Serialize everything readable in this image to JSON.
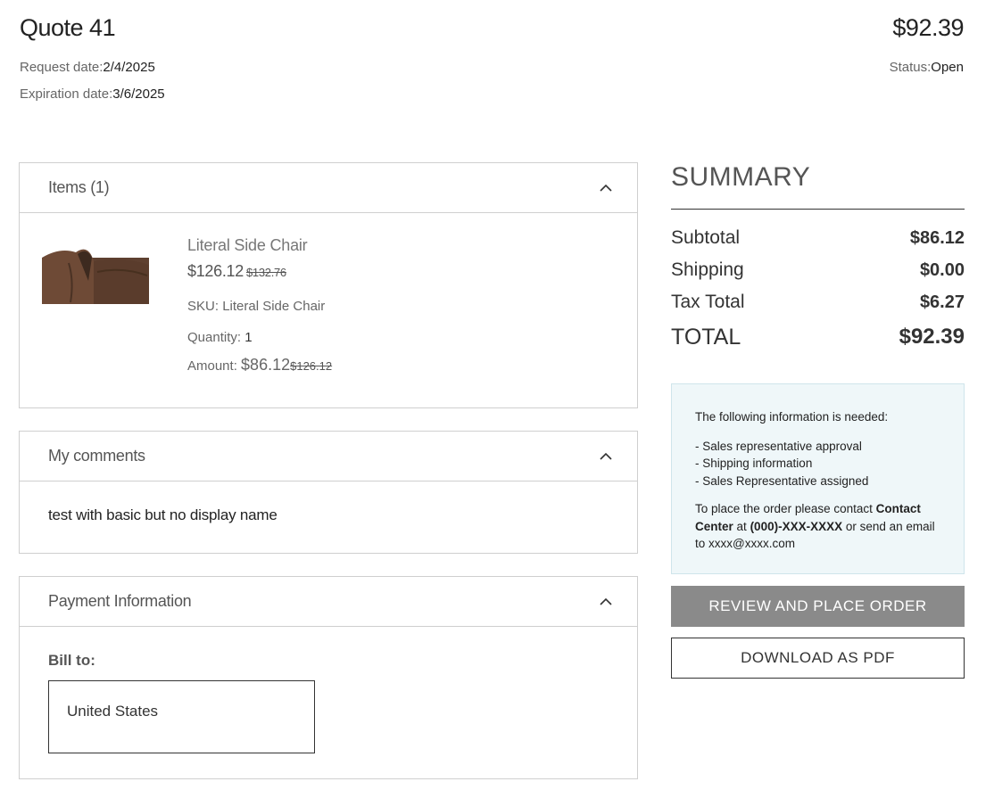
{
  "quote": {
    "title": "Quote 41",
    "total": "$92.39",
    "request_date_label": "Request date:",
    "request_date": "2/4/2025",
    "expiration_date_label": "Expiration date:",
    "expiration_date": "3/6/2025",
    "status_label": "Status:",
    "status": "Open"
  },
  "items_panel": {
    "title": "Items (1)",
    "items": [
      {
        "name": "Literal Side Chair",
        "price": "$126.12",
        "original_price": "$132.76",
        "sku_label": "SKU:",
        "sku": "Literal Side Chair",
        "quantity_label": "Quantity:",
        "quantity": "1",
        "amount_label": "Amount:",
        "amount": "$86.12",
        "original_amount": "$126.12"
      }
    ]
  },
  "comments_panel": {
    "title": "My comments",
    "text": "test with basic but no display name"
  },
  "payment_panel": {
    "title": "Payment Information",
    "bill_to_label": "Bill to:",
    "bill_to_address": "United States"
  },
  "summary": {
    "title": "SUMMARY",
    "rows": [
      {
        "label": "Subtotal",
        "value": "$86.12"
      },
      {
        "label": "Shipping",
        "value": "$0.00"
      },
      {
        "label": "Tax Total",
        "value": "$6.27"
      }
    ],
    "total_label": "TOTAL",
    "total_value": "$92.39"
  },
  "info": {
    "intro": "The following information is needed:",
    "requirements": [
      "- Sales representative approval",
      "- Shipping information",
      "- Sales Representative assigned"
    ],
    "contact_prefix": "To place the order please contact",
    "contact_name": "Contact Center",
    "contact_at": "at",
    "contact_phone": "(000)-XXX-XXXX",
    "contact_suffix": "or send an email to",
    "contact_email": "xxxx@xxxx.com"
  },
  "actions": {
    "review_label": "REVIEW AND PLACE ORDER",
    "download_label": "DOWNLOAD AS PDF"
  },
  "icons": {
    "collapse": "chevron-up-icon"
  }
}
